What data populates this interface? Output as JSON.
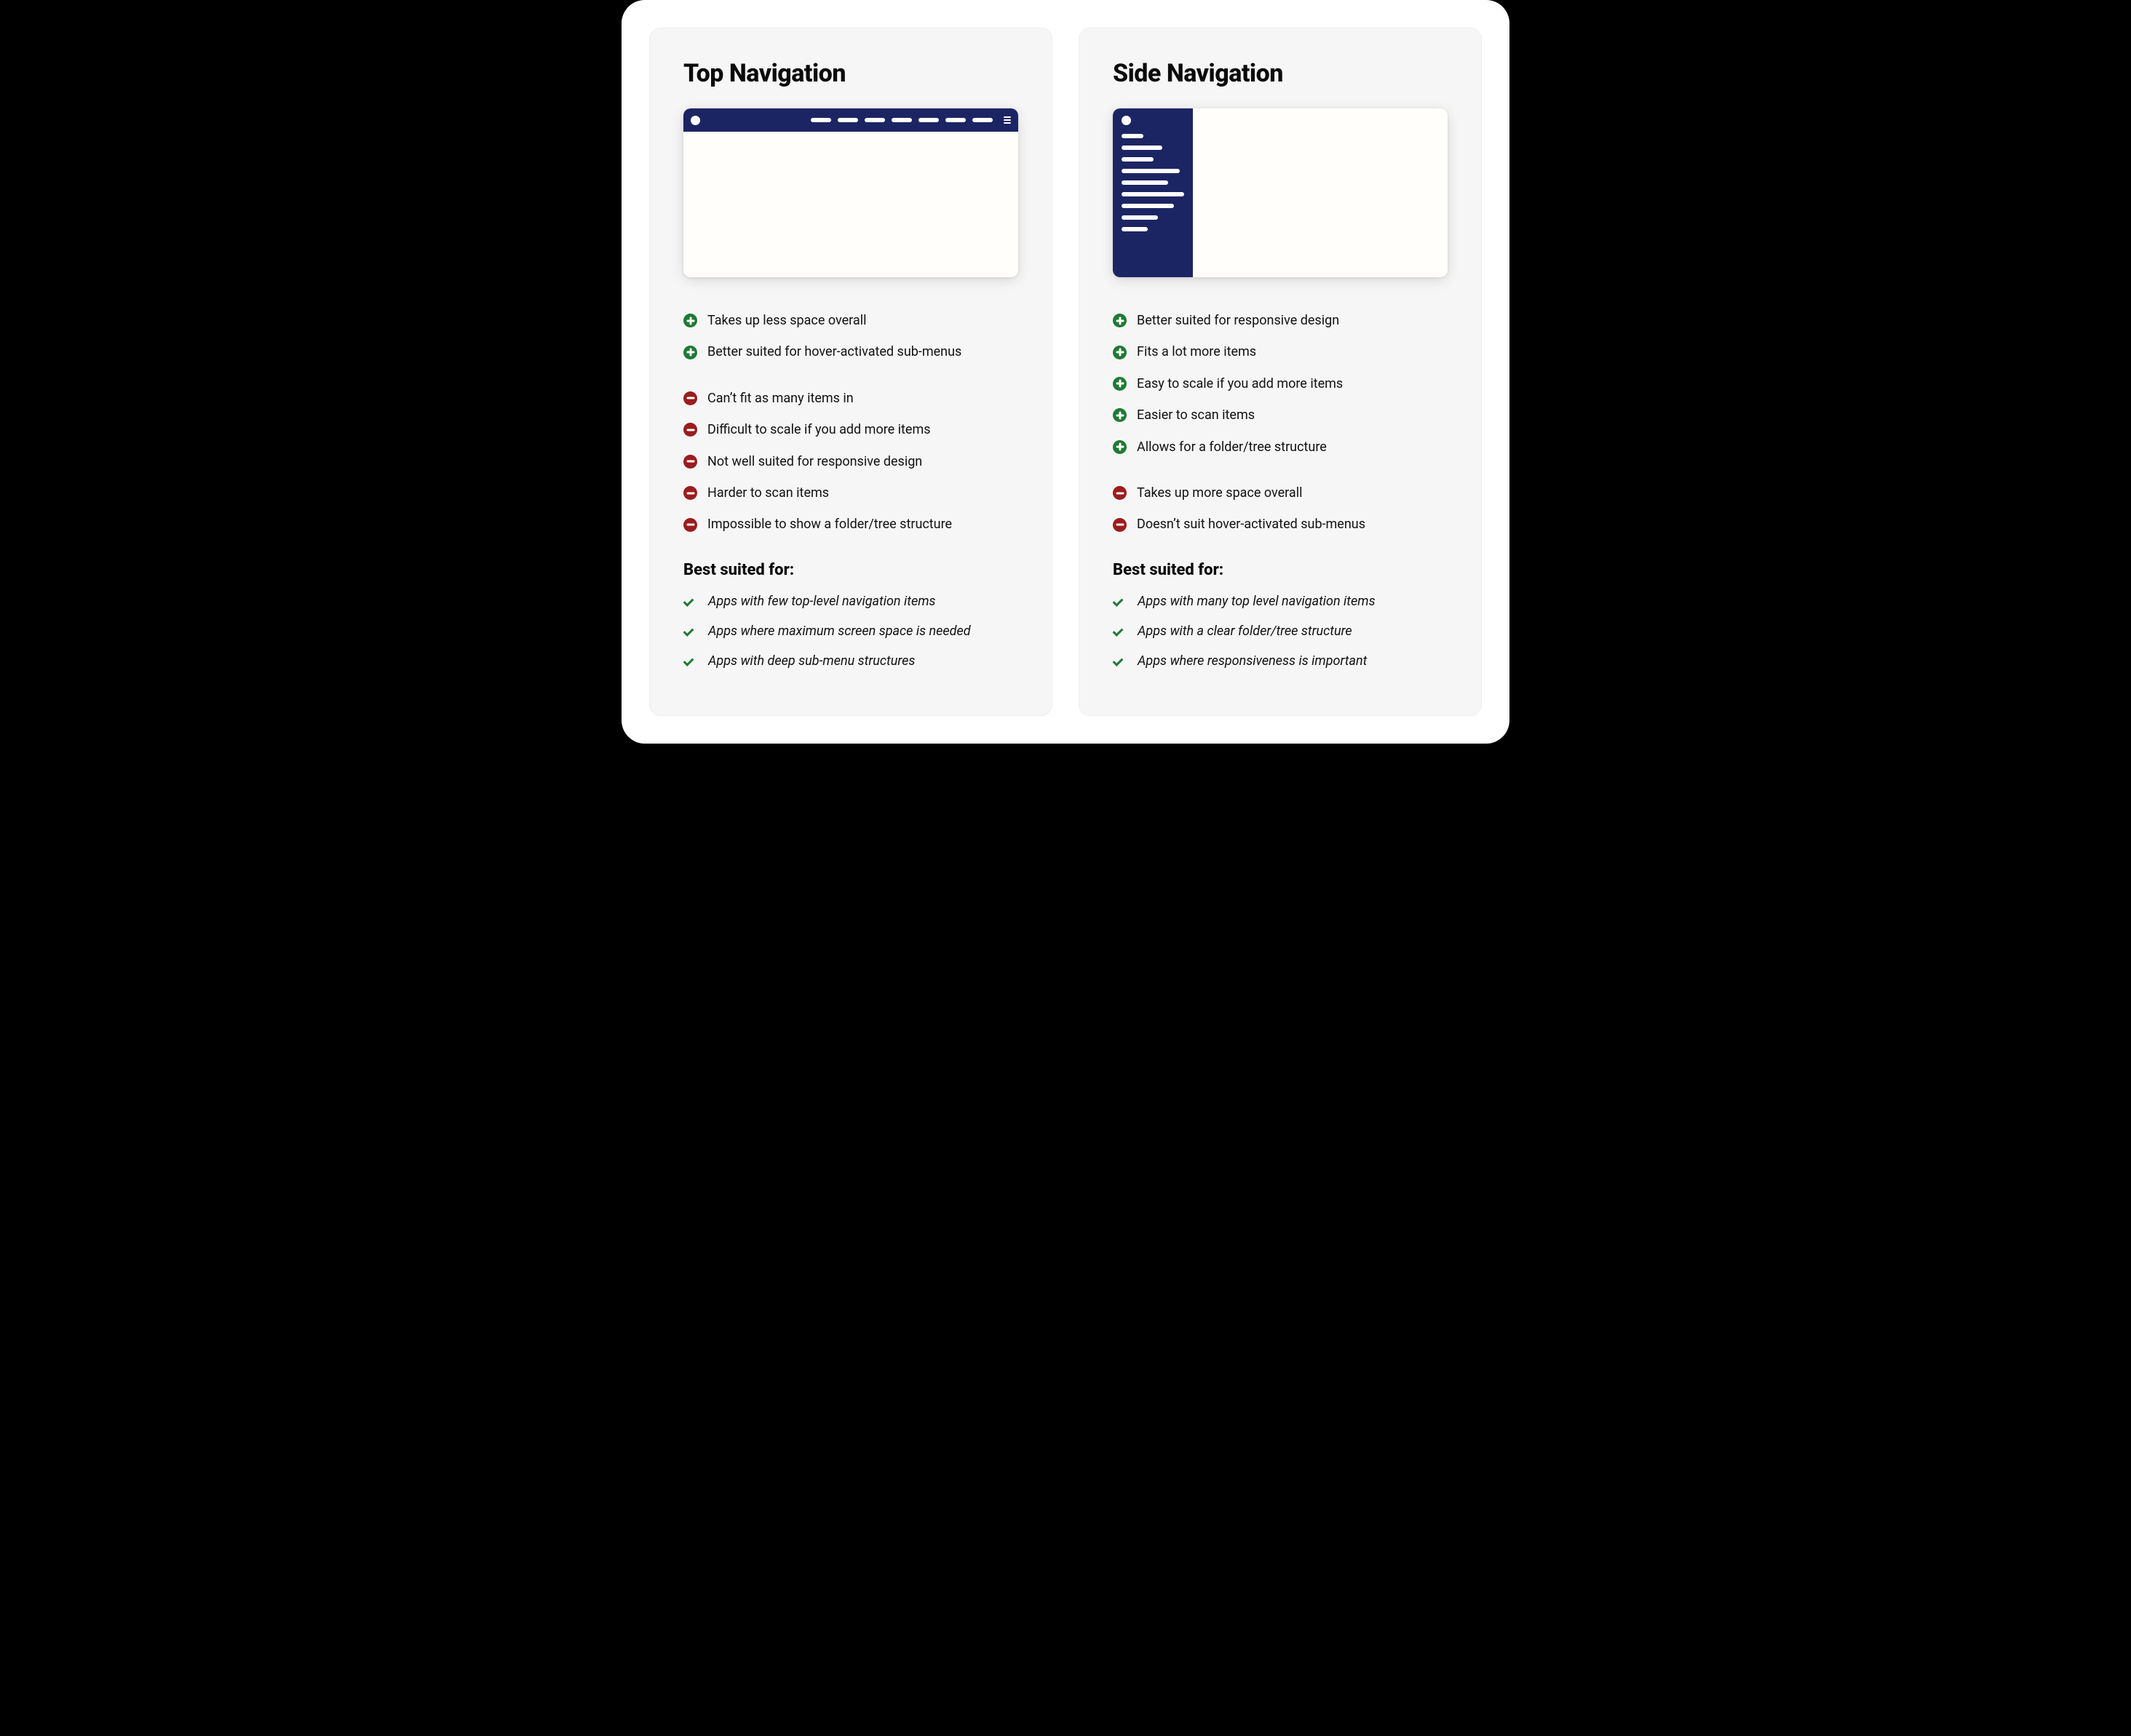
{
  "colors": {
    "nav_bg": "#1c2563",
    "pro_icon": "#1f7a33",
    "con_icon": "#9c1c1c",
    "check_icon": "#1f7a33",
    "card_bg": "#f6f6f6"
  },
  "suited_heading": "Best suited for:",
  "top_nav": {
    "title": "Top Navigation",
    "pros": [
      "Takes up less space overall",
      "Better suited for hover-activated sub-menus"
    ],
    "cons": [
      "Can’t fit as many items in",
      "Difficult to scale if you add more items",
      "Not well suited for responsive design",
      "Harder to scan items",
      "Impossible to show a folder/tree structure"
    ],
    "suited": [
      "Apps with few top-level navigation items",
      "Apps where maximum screen space is needed",
      "Apps with deep sub-menu structures"
    ]
  },
  "side_nav": {
    "title": "Side Navigation",
    "pros": [
      "Better suited for responsive design",
      "Fits a lot more items",
      "Easy to scale if you add more items",
      "Easier to scan items",
      "Allows for a folder/tree structure"
    ],
    "cons": [
      "Takes up more space overall",
      "Doesn’t suit hover-activated sub-menus"
    ],
    "suited": [
      "Apps with many top level navigation items",
      "Apps with a clear folder/tree structure",
      "Apps where responsiveness is important"
    ]
  }
}
